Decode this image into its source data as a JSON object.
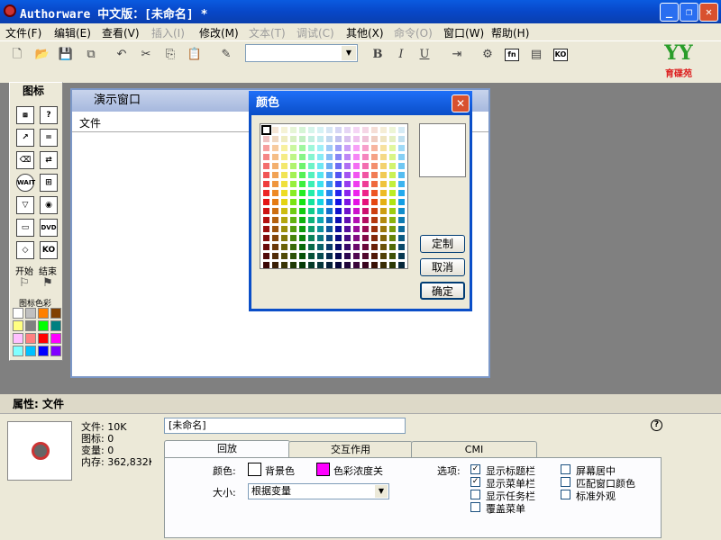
{
  "window": {
    "title": "Authorware 中文版：[未命名] *"
  },
  "menu": [
    {
      "label": "文件(F)",
      "enabled": true
    },
    {
      "label": "编辑(E)",
      "enabled": true
    },
    {
      "label": "查看(V)",
      "enabled": true
    },
    {
      "label": "插入(I)",
      "enabled": false
    },
    {
      "label": "修改(M)",
      "enabled": true
    },
    {
      "label": "文本(T)",
      "enabled": false
    },
    {
      "label": "调试(C)",
      "enabled": false
    },
    {
      "label": "其他(X)",
      "enabled": true
    },
    {
      "label": "命令(O)",
      "enabled": false
    },
    {
      "label": "窗口(W)",
      "enabled": true
    },
    {
      "label": "帮助(H)",
      "enabled": true
    }
  ],
  "toolbar": {
    "bold": "B",
    "italic": "I",
    "underline": "U",
    "fn_label": "fn",
    "ko_label": "KO",
    "font_value": ""
  },
  "logo": {
    "mark": "YY",
    "text": "育碟苑"
  },
  "icon_palette": {
    "title": "图标",
    "start_label": "开始",
    "end_label": "结束",
    "colors_label": "图标色彩",
    "wait_label": "WAIT",
    "ko_label": "KO",
    "dvd_label": "DVD",
    "swatches": [
      "#ffffff",
      "#c0c0c0",
      "#ff8000",
      "#804000",
      "#ffff80",
      "#808080",
      "#00ff00",
      "#008080",
      "#ffc0ff",
      "#ff8080",
      "#ff0000",
      "#ff00ff",
      "#80ffff",
      "#00c0ff",
      "#0000ff",
      "#8000ff"
    ]
  },
  "demo_window": {
    "title": "演示窗口",
    "menu": "文件"
  },
  "color_dialog": {
    "title": "颜色",
    "custom_button": "定制",
    "cancel_button": "取消",
    "ok_button": "确定",
    "selected_color": "#ffffff"
  },
  "properties": {
    "title": "属性: 文件",
    "file_size": "文件: 10K",
    "icons": "图标: 0",
    "variables": "变量: 0",
    "memory": "内存: 362,832K",
    "file_name": "[未命名]",
    "help_icon": "?",
    "tabs": [
      {
        "label": "回放",
        "active": true
      },
      {
        "label": "交互作用",
        "active": false
      },
      {
        "label": "CMI",
        "active": false
      }
    ],
    "color_label": "颜色:",
    "background_label": "背景色",
    "background_color": "#ffffff",
    "chroma_label": "色彩浓度关",
    "chroma_color": "#ff00ff",
    "size_label": "大小:",
    "size_value": "根据变量",
    "options_label": "选项:",
    "options": [
      {
        "label": "显示标题栏",
        "checked": true
      },
      {
        "label": "显示菜单栏",
        "checked": true
      },
      {
        "label": "显示任务栏",
        "checked": false
      },
      {
        "label": "覆盖菜单",
        "checked": false
      },
      {
        "label": "屏幕居中",
        "checked": false
      },
      {
        "label": "匹配窗口颜色",
        "checked": false
      },
      {
        "label": "标准外观",
        "checked": false
      }
    ]
  }
}
